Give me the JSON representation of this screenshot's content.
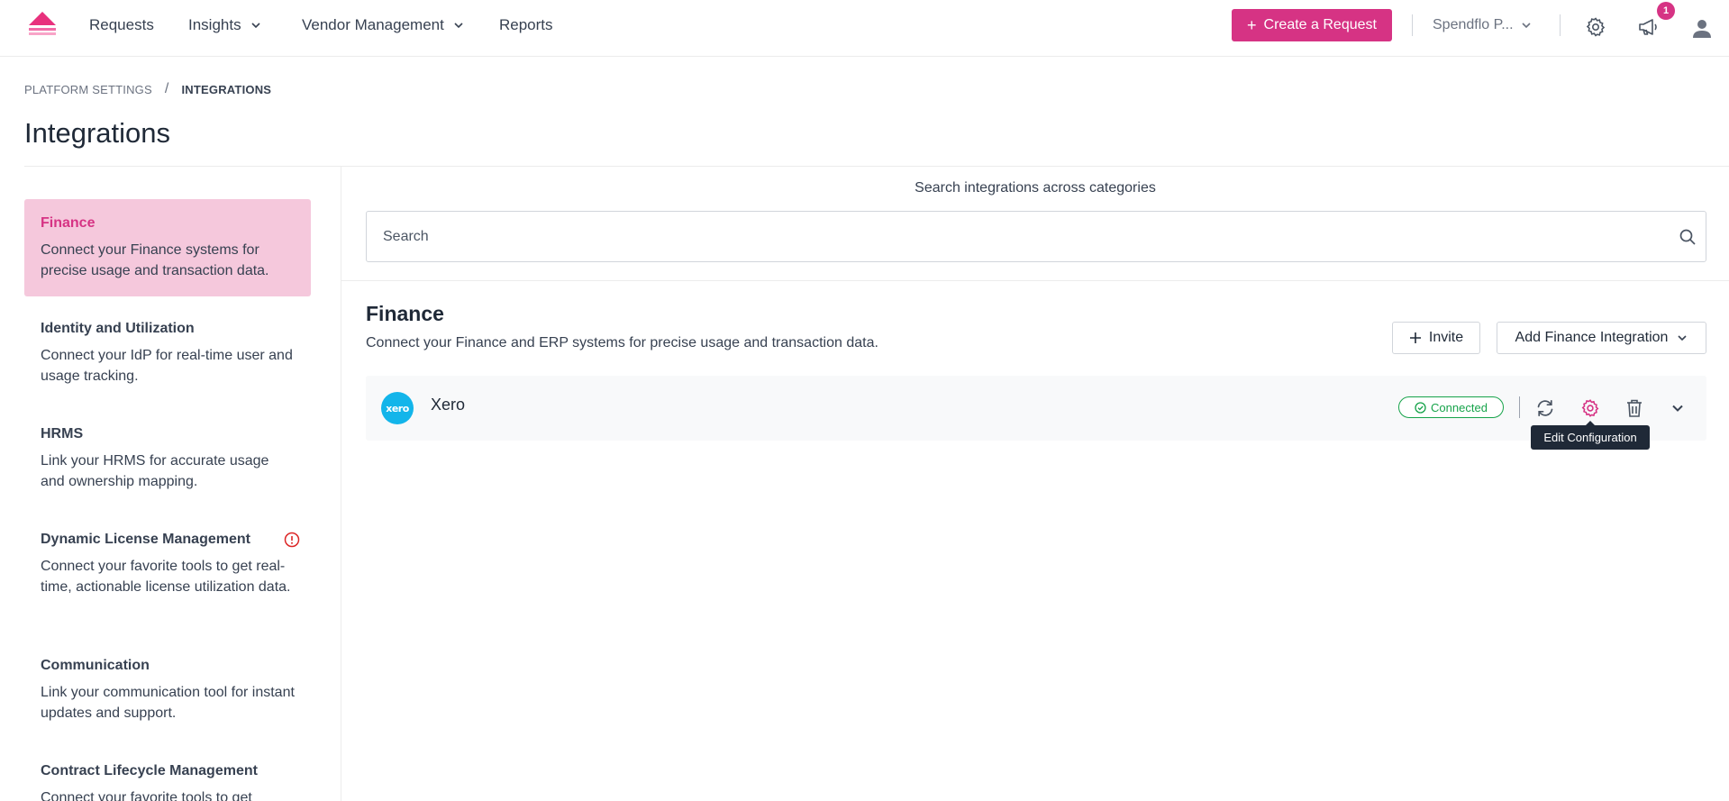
{
  "nav": {
    "items": [
      {
        "label": "Requests",
        "has_dropdown": false
      },
      {
        "label": "Insights",
        "has_dropdown": true
      },
      {
        "label": "Vendor Management",
        "has_dropdown": true
      },
      {
        "label": "Reports",
        "has_dropdown": false
      }
    ],
    "create_button": "Create a Request",
    "create_plus": "+",
    "org_label": "Spendflo P...",
    "notification_count": "1",
    "icons": [
      "logo-icon",
      "chevron-down-icon",
      "gear-icon",
      "megaphone-icon",
      "user-avatar-icon"
    ]
  },
  "breadcrumb": {
    "items": [
      "PLATFORM SETTINGS",
      "INTEGRATIONS"
    ],
    "separator": "/"
  },
  "page_title": "Integrations",
  "sidebar": {
    "categories": [
      {
        "title": "Finance",
        "description": "Connect your Finance systems for precise usage and transaction data.",
        "active": true
      },
      {
        "title": "Identity and Utilization",
        "description": "Connect your IdP for real-time user and usage tracking.",
        "active": false
      },
      {
        "title": "HRMS",
        "description": "Link your HRMS for accurate usage and ownership mapping.",
        "active": false
      },
      {
        "title": "Dynamic License Management",
        "description": "Connect your favorite tools to get real-time, actionable license utilization data.",
        "active": false,
        "warning": true
      },
      {
        "title": "Communication",
        "description": "Link your communication tool for instant updates and support.",
        "active": false
      },
      {
        "title": "Contract Lifecycle Management",
        "description": "Connect your favorite tools to get",
        "active": false
      }
    ]
  },
  "search": {
    "caption": "Search integrations across categories",
    "placeholder": "Search",
    "value": ""
  },
  "section": {
    "title": "Finance",
    "description": "Connect your Finance and ERP systems for precise usage and transaction data.",
    "invite_label": "Invite",
    "add_label": "Add Finance Integration"
  },
  "integration": {
    "logo_text": "xero",
    "name": "Xero",
    "status": "Connected",
    "tooltip": "Edit Configuration"
  },
  "colors": {
    "brand": "#d63384",
    "active_bg": "#f5c8dc",
    "success": "#16a34a",
    "xero": "#13b5ea"
  }
}
